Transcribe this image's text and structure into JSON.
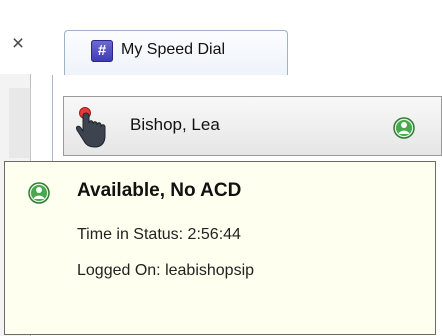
{
  "tab": {
    "close_glyph": "×",
    "title": "My Speed Dial",
    "icon": "speed-dial-icon",
    "icon_glyph": "#"
  },
  "speed_dial": {
    "contact_name": "Bishop, Lea",
    "contact_icon": "hand-cursor-icon",
    "presence_icon": "available-presence-icon"
  },
  "tooltip": {
    "status": "Available, No ACD",
    "time_in_status": "Time in Status: 2:56:44",
    "logged_on": "Logged On: leabishopsip"
  },
  "colors": {
    "tooltip_background": "#fffff0",
    "presence_green": "#3a9b3f",
    "tab_icon_purple": "#4d48c2"
  }
}
